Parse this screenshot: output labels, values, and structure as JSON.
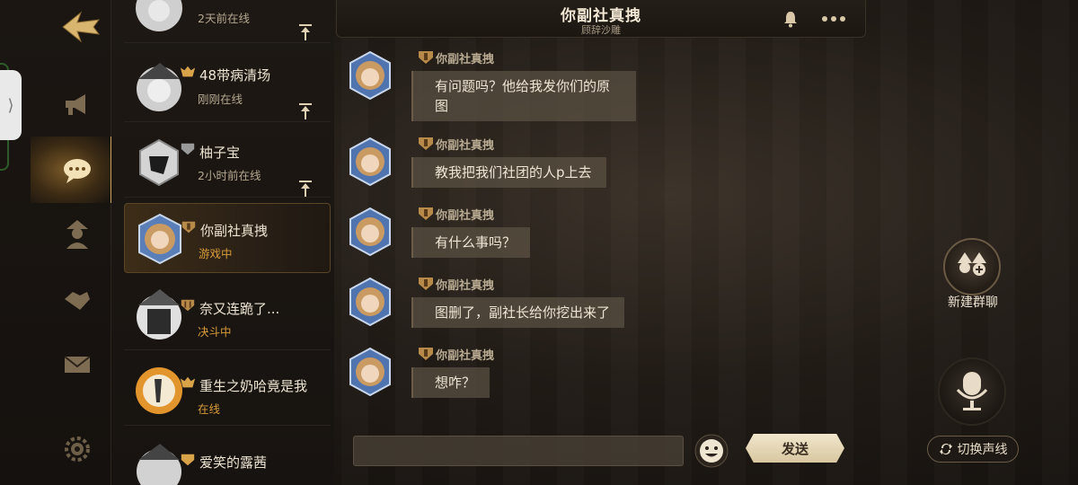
{
  "chat": {
    "title": "你副社真拽",
    "subtitle": "顾辞沙雕"
  },
  "contacts": [
    {
      "name": "",
      "status": "2天前在线",
      "pinned": true
    },
    {
      "name": "48带病清场",
      "status": "刚刚在线",
      "pinned": true
    },
    {
      "name": "柚子宝",
      "status": "2小时前在线",
      "pinned": true
    },
    {
      "name": "你副社真拽",
      "status": "游戏中",
      "status_color": "gold",
      "selected": true
    },
    {
      "name": "奈又连跪了...",
      "status": "决斗中",
      "status_color": "gold"
    },
    {
      "name": "重生之奶哈竟是我",
      "status": "在线",
      "status_color": "gold"
    },
    {
      "name": "爱笑的露茜",
      "status": ""
    }
  ],
  "messages": [
    {
      "sender": "你副社真拽",
      "text": "有问题吗？他给我发你们的原图"
    },
    {
      "sender": "你副社真拽",
      "text": "教我把我们社团的人p上去"
    },
    {
      "sender": "你副社真拽",
      "text": "有什么事吗？"
    },
    {
      "sender": "你副社真拽",
      "text": "图删了，副社长给你挖出来了"
    },
    {
      "sender": "你副社真拽",
      "text": "想咋？"
    }
  ],
  "input": {
    "placeholder": ""
  },
  "buttons": {
    "send": "发送",
    "new_group": "新建群聊",
    "switch_voice": "切换声线"
  },
  "colors": {
    "accent_gold": "#c9a25a",
    "status_gold": "#d89b3a",
    "bubble": "#5c5244"
  },
  "icons": {
    "rail": [
      "back-arrow-icon",
      "megaphone-icon",
      "chat-bubble-icon",
      "character-icon",
      "handshake-icon",
      "mail-icon",
      "settings-gear-icon"
    ]
  }
}
